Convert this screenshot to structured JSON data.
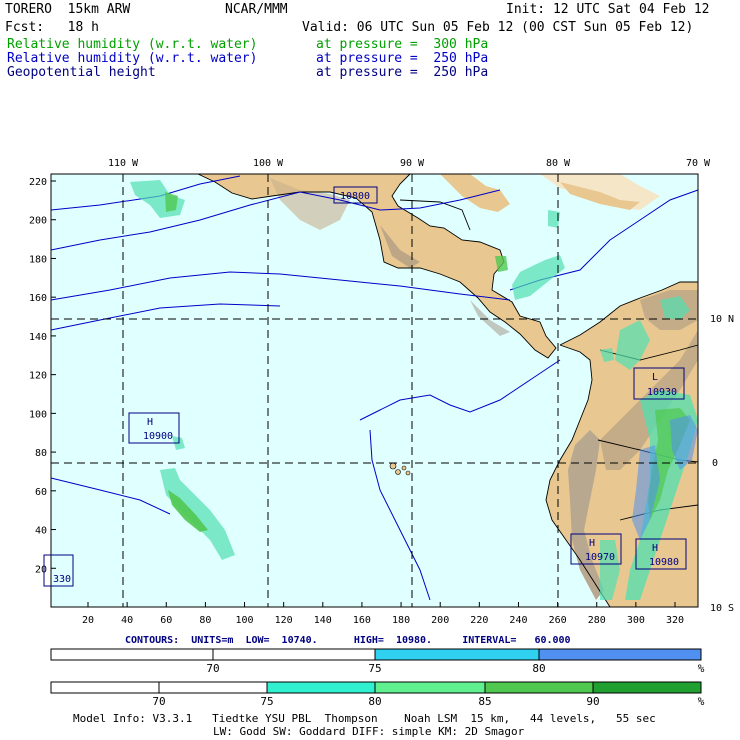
{
  "header": {
    "model": "TORERO  15km ARW",
    "center": "NCAR/MMM",
    "init": "Init: 12 UTC Sat 04 Feb 12",
    "fcst": "Fcst:   18 h",
    "valid": "Valid: 06 UTC Sun 05 Feb 12 (00 CST Sun 05 Feb 12)",
    "fields": [
      {
        "name": "Relative humidity (w.r.t. water)",
        "level": "at pressure =  300 hPa",
        "color": "#00a000"
      },
      {
        "name": "Relative humidity (w.r.t. water)",
        "level": "at pressure =  250 hPa",
        "color": "#0000c8"
      },
      {
        "name": "Geopotential height",
        "level": "at pressure =  250 hPa",
        "color": "#000080"
      }
    ]
  },
  "map": {
    "lon_labels": [
      "110 W",
      "100 W",
      "90 W",
      "80 W",
      "70 W"
    ],
    "lat_labels": [
      "10 N",
      "0",
      "10 S"
    ],
    "y_ticks": [
      220,
      200,
      180,
      160,
      140,
      120,
      100,
      80,
      60,
      40,
      20
    ],
    "x_ticks": [
      20,
      40,
      60,
      80,
      100,
      120,
      140,
      160,
      180,
      200,
      220,
      240,
      260,
      280,
      300,
      320
    ],
    "ocean_color": "#e0ffff",
    "land_color": "#e8c890",
    "mountain_color": "#a09080"
  },
  "annotations": [
    {
      "type": "value",
      "text": "10800"
    },
    {
      "type": "H",
      "text": "10900"
    },
    {
      "type": "L",
      "text": "10930"
    },
    {
      "type": "H",
      "text": "10970"
    },
    {
      "type": "H",
      "text": "10980"
    },
    {
      "type": "partial",
      "text": "330"
    }
  ],
  "contours": {
    "units_label": "CONTOURS:",
    "units": "UNITS=m",
    "low": "LOW=  10740.",
    "high": "HIGH=  10980.",
    "interval": "INTERVAL=   60.000"
  },
  "colorbar_250": {
    "labels": [
      "70",
      "75",
      "80"
    ],
    "unit": "%",
    "colors": [
      "#ffffff",
      "#ffffff",
      "#30d0f0",
      "#5090f0"
    ]
  },
  "colorbar_300": {
    "labels": [
      "70",
      "75",
      "80",
      "85",
      "90"
    ],
    "unit": "%",
    "colors": [
      "#ffffff",
      "#ffffff",
      "#30f0d0",
      "#60f090",
      "#50c850",
      "#20a030"
    ]
  },
  "footer": {
    "line1": "Model Info: V3.3.1   Tiedtke YSU PBL  Thompson    Noah LSM  15 km,   44 levels,   55 sec",
    "line2": "LW: Godd SW: Goddard DIFF: simple KM: 2D Smagor"
  }
}
